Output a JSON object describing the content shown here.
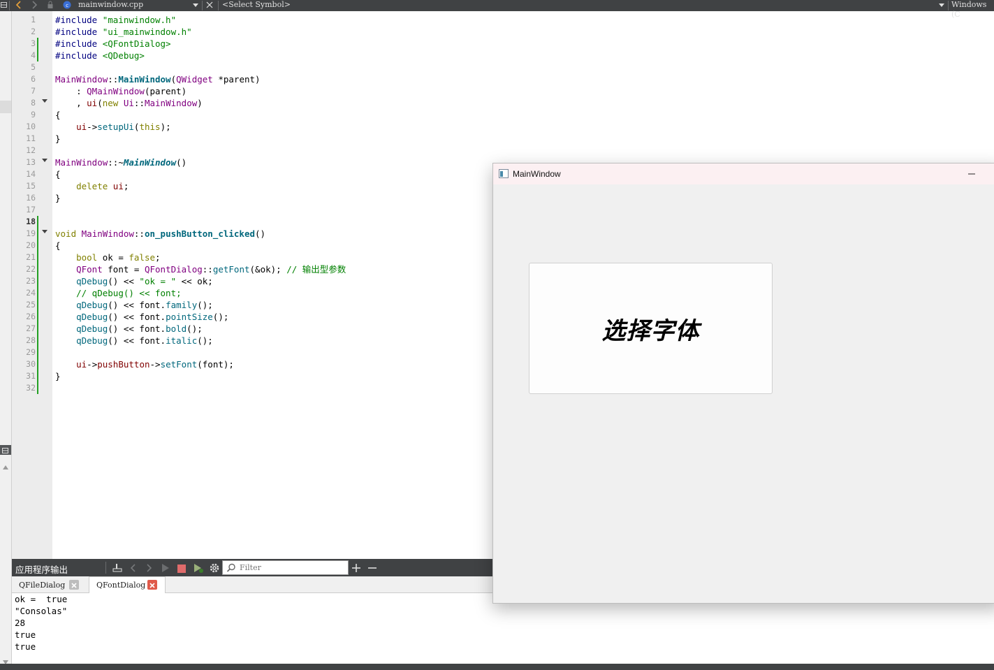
{
  "toolbar": {
    "file_name": "mainwindow.cpp",
    "symbol_placeholder": "<Select Symbol>",
    "line_ending": "Windows (C"
  },
  "editor": {
    "current_line": 18,
    "lines": [
      {
        "n": "1",
        "t": [
          [
            "#include ",
            "pp"
          ],
          [
            "\"mainwindow.h\"",
            "str"
          ]
        ]
      },
      {
        "n": "2",
        "t": [
          [
            "#include ",
            "pp"
          ],
          [
            "\"ui_mainwindow.h\"",
            "str"
          ]
        ]
      },
      {
        "n": "3",
        "t": [
          [
            "#include ",
            "pp"
          ],
          [
            "<QFontDialog>",
            "str"
          ]
        ]
      },
      {
        "n": "4",
        "t": [
          [
            "#include ",
            "pp"
          ],
          [
            "<QDebug>",
            "str"
          ]
        ]
      },
      {
        "n": "5",
        "t": []
      },
      {
        "n": "6",
        "t": [
          [
            "MainWindow",
            "cls"
          ],
          [
            "::",
            ""
          ],
          [
            "MainWindow",
            "fnb"
          ],
          [
            "(",
            ""
          ],
          [
            "QWidget",
            "cls"
          ],
          [
            " *parent)",
            ""
          ]
        ]
      },
      {
        "n": "7",
        "t": [
          [
            "    : ",
            ""
          ],
          [
            "QMainWindow",
            "cls"
          ],
          [
            "(parent)",
            ""
          ]
        ]
      },
      {
        "n": "8",
        "t": [
          [
            "    , ",
            ""
          ],
          [
            "ui",
            "mem"
          ],
          [
            "(",
            ""
          ],
          [
            "new",
            "kw"
          ],
          [
            " ",
            ""
          ],
          [
            "Ui",
            "cls"
          ],
          [
            "::",
            ""
          ],
          [
            "MainWindow",
            "cls"
          ],
          [
            ")",
            ""
          ]
        ]
      },
      {
        "n": "9",
        "t": [
          [
            "{",
            ""
          ]
        ]
      },
      {
        "n": "10",
        "t": [
          [
            "    ",
            ""
          ],
          [
            "ui",
            "mem"
          ],
          [
            "->",
            ""
          ],
          [
            "setupUi",
            "fn"
          ],
          [
            "(",
            ""
          ],
          [
            "this",
            "kw"
          ],
          [
            ");",
            ""
          ]
        ]
      },
      {
        "n": "11",
        "t": [
          [
            "}",
            ""
          ]
        ]
      },
      {
        "n": "12",
        "t": []
      },
      {
        "n": "13",
        "t": [
          [
            "MainWindow",
            "cls"
          ],
          [
            "::~",
            ""
          ],
          [
            "MainWindow",
            "fnbi"
          ],
          [
            "()",
            ""
          ]
        ]
      },
      {
        "n": "14",
        "t": [
          [
            "{",
            ""
          ]
        ]
      },
      {
        "n": "15",
        "t": [
          [
            "    ",
            ""
          ],
          [
            "delete",
            "kw"
          ],
          [
            " ",
            ""
          ],
          [
            "ui",
            "mem"
          ],
          [
            ";",
            ""
          ]
        ]
      },
      {
        "n": "16",
        "t": [
          [
            "}",
            ""
          ]
        ]
      },
      {
        "n": "17",
        "t": []
      },
      {
        "n": "18",
        "t": []
      },
      {
        "n": "19",
        "t": [
          [
            "void",
            "kw"
          ],
          [
            " ",
            ""
          ],
          [
            "MainWindow",
            "cls"
          ],
          [
            "::",
            ""
          ],
          [
            "on_pushButton_clicked",
            "fnb"
          ],
          [
            "()",
            ""
          ]
        ]
      },
      {
        "n": "20",
        "t": [
          [
            "{",
            ""
          ]
        ]
      },
      {
        "n": "21",
        "t": [
          [
            "    ",
            ""
          ],
          [
            "bool",
            "kw"
          ],
          [
            " ok = ",
            ""
          ],
          [
            "false",
            "kw"
          ],
          [
            ";",
            ""
          ]
        ]
      },
      {
        "n": "22",
        "t": [
          [
            "    ",
            ""
          ],
          [
            "QFont",
            "cls"
          ],
          [
            " font = ",
            ""
          ],
          [
            "QFontDialog",
            "cls"
          ],
          [
            "::",
            ""
          ],
          [
            "getFont",
            "fn"
          ],
          [
            "(&ok); ",
            ""
          ],
          [
            "// 输出型参数",
            "cm"
          ]
        ]
      },
      {
        "n": "23",
        "t": [
          [
            "    ",
            ""
          ],
          [
            "qDebug",
            "fn"
          ],
          [
            "() << ",
            ""
          ],
          [
            "\"ok = \"",
            "str"
          ],
          [
            " << ok;",
            ""
          ]
        ]
      },
      {
        "n": "24",
        "t": [
          [
            "    ",
            ""
          ],
          [
            "// qDebug() << font;",
            "cm"
          ]
        ]
      },
      {
        "n": "25",
        "t": [
          [
            "    ",
            ""
          ],
          [
            "qDebug",
            "fn"
          ],
          [
            "() << font.",
            ""
          ],
          [
            "family",
            "fn"
          ],
          [
            "();",
            ""
          ]
        ]
      },
      {
        "n": "26",
        "t": [
          [
            "    ",
            ""
          ],
          [
            "qDebug",
            "fn"
          ],
          [
            "() << font.",
            ""
          ],
          [
            "pointSize",
            "fn"
          ],
          [
            "();",
            ""
          ]
        ]
      },
      {
        "n": "27",
        "t": [
          [
            "    ",
            ""
          ],
          [
            "qDebug",
            "fn"
          ],
          [
            "() << font.",
            ""
          ],
          [
            "bold",
            "fn"
          ],
          [
            "();",
            ""
          ]
        ]
      },
      {
        "n": "28",
        "t": [
          [
            "    ",
            ""
          ],
          [
            "qDebug",
            "fn"
          ],
          [
            "() << font.",
            ""
          ],
          [
            "italic",
            "fn"
          ],
          [
            "();",
            ""
          ]
        ]
      },
      {
        "n": "29",
        "t": []
      },
      {
        "n": "30",
        "t": [
          [
            "    ",
            ""
          ],
          [
            "ui",
            "mem"
          ],
          [
            "->",
            ""
          ],
          [
            "pushButton",
            "mem"
          ],
          [
            "->",
            ""
          ],
          [
            "setFont",
            "fn"
          ],
          [
            "(font);",
            ""
          ]
        ]
      },
      {
        "n": "31",
        "t": [
          [
            "}",
            ""
          ]
        ]
      },
      {
        "n": "32",
        "t": []
      }
    ]
  },
  "output_pane": {
    "title": "应用程序输出",
    "filter_placeholder": "Filter",
    "tabs": [
      {
        "label": "QFileDialog",
        "active": false
      },
      {
        "label": "QFontDialog",
        "active": true
      }
    ],
    "lines": [
      "ok =  true",
      "\"Consolas\"",
      "28",
      "true",
      "true"
    ]
  },
  "main_window": {
    "title": "MainWindow",
    "button_label": "选择字体"
  },
  "colors": {
    "toolbar_bg": "#404244",
    "modified_marker": "#22a022",
    "close_tab_red": "#e05a4a",
    "stop_button": "#e06b6b"
  },
  "icons": [
    "back-arrow-icon",
    "forward-arrow-icon",
    "lock-icon",
    "file-type-icon",
    "dropdown-arrow-icon",
    "close-icon",
    "fold-arrow-icon",
    "clear-icon",
    "run-icon",
    "stop-icon",
    "debug-run-icon",
    "gear-icon",
    "search-icon",
    "plus-icon",
    "minus-icon",
    "minimize-icon",
    "window-icon"
  ]
}
